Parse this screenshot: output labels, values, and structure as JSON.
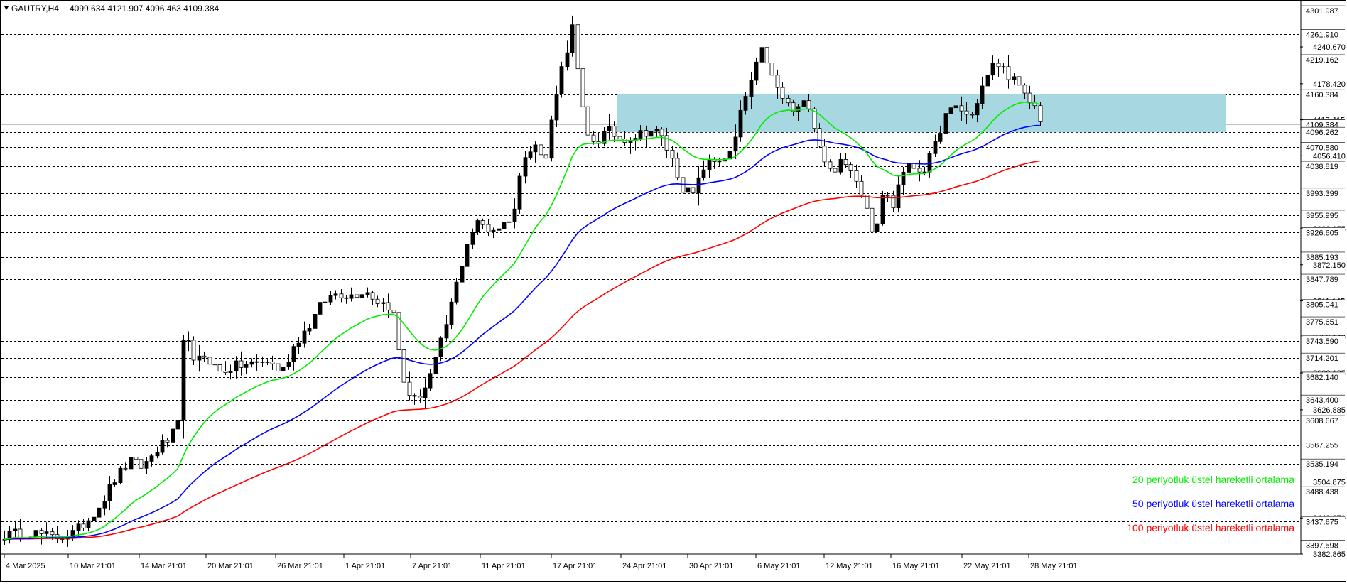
{
  "header": {
    "symbol": "GAUTRY,H4",
    "ohlc": "4099.634 4121.907 4096.463 4109.384"
  },
  "colors": {
    "ema20": "#00ee00",
    "ema50": "#0000ff",
    "ema100": "#ff0000",
    "zone": "#a7d7e1",
    "candle": "#000000"
  },
  "chart_data": {
    "type": "line",
    "ylim": [
      3382.865,
      4320
    ],
    "y_scale_labels": [
      4240.67,
      4178.42,
      4117.415,
      4056.41,
      3933.155,
      3872.15,
      3811.145,
      3750.14,
      3689.135,
      3626.885,
      3504.875,
      3443.87,
      3382.865
    ],
    "price_levels": [
      4301.987,
      4261.91,
      4219.162,
      4160.384,
      4109.384,
      4096.262,
      4070.88,
      4038.819,
      3993.399,
      3955.995,
      3926.605,
      3885.193,
      3847.789,
      3805.041,
      3775.651,
      3743.59,
      3714.201,
      3682.14,
      3643.4,
      3608.667,
      3567.255,
      3535.194,
      3488.438,
      3437.675,
      3397.598
    ],
    "current_price": 4109.384,
    "x_labels": [
      "4 Mar 2025",
      "10 Mar 21:01",
      "14 Mar 21:01",
      "20 Mar 21:01",
      "26 Mar 21:01",
      "1 Apr 21:01",
      "7 Apr 21:01",
      "11 Apr 21:01",
      "17 Apr 21:01",
      "24 Apr 21:01",
      "30 Apr 21:01",
      "6 May 21:01",
      "12 May 21:01",
      "16 May 21:01",
      "22 May 21:01",
      "28 May 21:01"
    ],
    "zone": {
      "price_top": 4160.384,
      "price_bottom": 4096.262,
      "start_index": 178
    },
    "legend": [
      {
        "label": "20 periyotluk üstel hareketli ortalama",
        "color": "#00ee00"
      },
      {
        "label": "50 periyotluk üstel hareketli ortalama",
        "color": "#0000ff"
      },
      {
        "label": "100 periyotluk üstel hareketli ortalama",
        "color": "#ff0000"
      }
    ],
    "candle_count": 198,
    "anchors": [
      [
        0,
        3415
      ],
      [
        8,
        3420
      ],
      [
        14,
        3410
      ],
      [
        20,
        3418
      ],
      [
        24,
        3440
      ],
      [
        28,
        3470
      ],
      [
        32,
        3510
      ],
      [
        36,
        3540
      ],
      [
        40,
        3530
      ],
      [
        44,
        3560
      ],
      [
        48,
        3580
      ],
      [
        51,
        3610
      ],
      [
        52,
        3820
      ],
      [
        54,
        3700
      ],
      [
        58,
        3720
      ],
      [
        62,
        3690
      ],
      [
        66,
        3700
      ],
      [
        72,
        3705
      ],
      [
        76,
        3710
      ],
      [
        80,
        3690
      ],
      [
        84,
        3740
      ],
      [
        88,
        3770
      ],
      [
        92,
        3810
      ],
      [
        96,
        3825
      ],
      [
        100,
        3820
      ],
      [
        104,
        3830
      ],
      [
        108,
        3810
      ],
      [
        112,
        3800
      ],
      [
        115,
        3680
      ],
      [
        118,
        3640
      ],
      [
        121,
        3660
      ],
      [
        124,
        3700
      ],
      [
        127,
        3760
      ],
      [
        131,
        3850
      ],
      [
        134,
        3920
      ],
      [
        137,
        3945
      ],
      [
        140,
        3930
      ],
      [
        144,
        3940
      ],
      [
        147,
        3960
      ],
      [
        150,
        4060
      ],
      [
        153,
        4080
      ],
      [
        156,
        4040
      ],
      [
        159,
        4160
      ],
      [
        162,
        4230
      ],
      [
        164,
        4275
      ],
      [
        166,
        4170
      ],
      [
        168,
        4090
      ],
      [
        171,
        4080
      ],
      [
        174,
        4100
      ],
      [
        178,
        4085
      ],
      [
        182,
        4090
      ],
      [
        186,
        4100
      ],
      [
        189,
        4095
      ],
      [
        192,
        4060
      ],
      [
        196,
        4000
      ],
      [
        199,
        3990
      ],
      [
        202,
        4040
      ],
      [
        206,
        4050
      ],
      [
        210,
        4060
      ],
      [
        213,
        4140
      ],
      [
        216,
        4190
      ],
      [
        219,
        4240
      ],
      [
        222,
        4180
      ],
      [
        225,
        4150
      ],
      [
        228,
        4130
      ],
      [
        232,
        4150
      ],
      [
        235,
        4080
      ],
      [
        238,
        4030
      ],
      [
        242,
        4045
      ],
      [
        246,
        4020
      ],
      [
        249,
        3970
      ],
      [
        251,
        3920
      ],
      [
        254,
        4010
      ],
      [
        256,
        3960
      ],
      [
        259,
        4030
      ],
      [
        262,
        4040
      ],
      [
        265,
        4030
      ],
      [
        268,
        4060
      ],
      [
        271,
        4120
      ],
      [
        275,
        4140
      ],
      [
        279,
        4120
      ],
      [
        282,
        4170
      ],
      [
        286,
        4215
      ],
      [
        289,
        4200
      ],
      [
        292,
        4180
      ],
      [
        295,
        4150
      ],
      [
        297,
        4145
      ],
      [
        299,
        4120
      ]
    ]
  }
}
